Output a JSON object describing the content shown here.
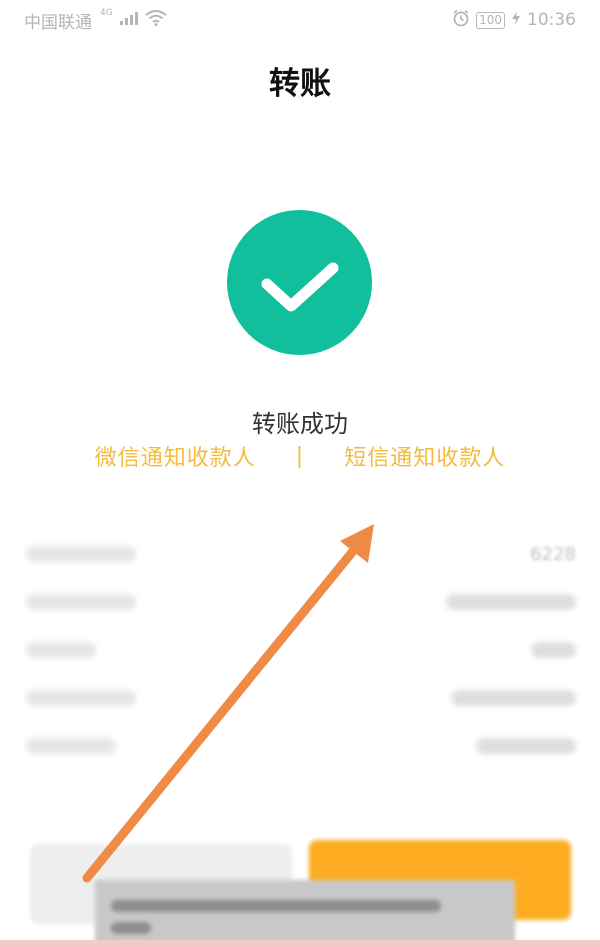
{
  "status_bar": {
    "carrier": "中国联通",
    "network": "4G",
    "battery": "100",
    "time": "10:36"
  },
  "header": {
    "title": "转账"
  },
  "result": {
    "message": "转账成功",
    "notify_wechat": "微信通知收款人",
    "divider": "|",
    "notify_sms": "短信通知收款人"
  },
  "details": {
    "first_value": "6228"
  },
  "colors": {
    "success_green": "#12bf9c",
    "notify_yellow": "#f3bb3f",
    "primary_orange": "#fdac22",
    "annotation_orange": "#ef8b45"
  }
}
